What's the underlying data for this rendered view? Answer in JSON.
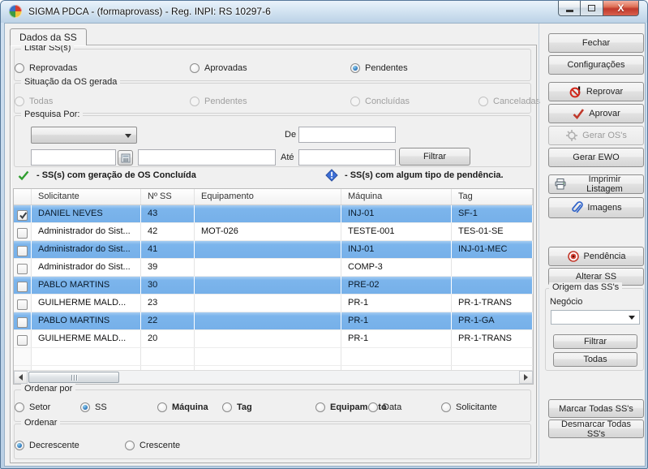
{
  "window": {
    "title": "SIGMA PDCA -  (formaprovass)  - Reg. INPI: RS 10297-6"
  },
  "tab_label": "Dados da SS",
  "listar": {
    "legend": "Listar SS(s)",
    "options": [
      {
        "label": "Aprovadas",
        "selected": false
      },
      {
        "label": "Pendentes",
        "selected": true
      },
      {
        "label": "Reprovadas",
        "selected": false
      }
    ]
  },
  "situacao": {
    "legend": "Situação da OS gerada",
    "options": [
      {
        "label": "Pendentes",
        "disabled": true
      },
      {
        "label": "Concluídas",
        "disabled": true
      },
      {
        "label": "Canceladas",
        "disabled": true
      },
      {
        "label": "Todas",
        "disabled": true
      }
    ]
  },
  "pesquisa": {
    "legend": "Pesquisa Por:",
    "combo_value": "",
    "search_value": "",
    "search2_value": "",
    "de_label": "De",
    "de_value": "",
    "ate_label": "Até",
    "ate_value": "",
    "filtrar_label": "Filtrar"
  },
  "legend_items": [
    {
      "icon": "green-check-icon",
      "text": "- SS(s) com geração de OS Concluída"
    },
    {
      "icon": "blue-pendency-icon",
      "text": "- SS(s) com algum tipo de pendência."
    }
  ],
  "table": {
    "columns": [
      "Solicitante",
      "Nº SS",
      "Equipamento",
      "Máquina",
      "Tag"
    ],
    "rows": [
      {
        "checked": true,
        "highlighted": true,
        "cells": [
          "DANIEL NEVES",
          "43",
          "",
          "INJ-01",
          "SF-1"
        ]
      },
      {
        "checked": false,
        "highlighted": false,
        "cells": [
          "Administrador do Sist...",
          "42",
          "MOT-026",
          "TESTE-001",
          "TES-01-SE"
        ]
      },
      {
        "checked": false,
        "highlighted": true,
        "cells": [
          "Administrador do Sist...",
          "41",
          "",
          "INJ-01",
          "INJ-01-MEC"
        ]
      },
      {
        "checked": false,
        "highlighted": false,
        "cells": [
          "Administrador do Sist...",
          "39",
          "",
          "COMP-3",
          ""
        ]
      },
      {
        "checked": false,
        "highlighted": true,
        "cells": [
          "PABLO MARTINS",
          "30",
          "",
          "PRE-02",
          ""
        ]
      },
      {
        "checked": false,
        "highlighted": false,
        "cells": [
          "GUILHERME MALD...",
          "23",
          "",
          "PR-1",
          "PR-1-TRANS"
        ]
      },
      {
        "checked": false,
        "highlighted": true,
        "cells": [
          "PABLO MARTINS",
          "22",
          "",
          "PR-1",
          "PR-1-GA"
        ]
      },
      {
        "checked": false,
        "highlighted": false,
        "cells": [
          "GUILHERME MALD...",
          "20",
          "",
          "PR-1",
          "PR-1-TRANS"
        ]
      }
    ]
  },
  "ordenar_por": {
    "legend": "Ordenar por",
    "options": [
      {
        "label": "SS",
        "selected": true
      },
      {
        "label": "Máquina",
        "bold": true
      },
      {
        "label": "Tag",
        "bold": true
      },
      {
        "label": "Equipamento",
        "bold": true
      },
      {
        "label": "Data"
      },
      {
        "label": "Solicitante"
      },
      {
        "label": "Setor"
      }
    ]
  },
  "ordenar": {
    "legend": "Ordenar",
    "options": [
      {
        "label": "Crescente"
      },
      {
        "label": "Decrescente",
        "selected": true
      }
    ]
  },
  "sidebar": {
    "buttons": {
      "fechar": "Fechar",
      "configuracoes": "Configurações",
      "reprovar": "Reprovar",
      "aprovar": "Aprovar",
      "gerar_os": "Gerar OS's",
      "gerar_ewo": "Gerar EWO",
      "imprimir": "Imprimir Listagem",
      "imagens": "Imagens",
      "pendencia": "Pendência",
      "alterar": "Alterar SS",
      "filtrar": "Filtrar",
      "todas": "Todas",
      "marcar": "Marcar Todas SS's",
      "desmarcar": "Desmarcar Todas SS's"
    },
    "origem": {
      "legend": "Origem das SS's",
      "negocio_label": "Negócio",
      "negocio_value": ""
    }
  },
  "colors": {
    "row_highlight": "#7cb5ec",
    "approve_check_red": "#c0392b",
    "legend_green": "#2f9e2f",
    "pendency_blue": "#3d6fd6"
  }
}
